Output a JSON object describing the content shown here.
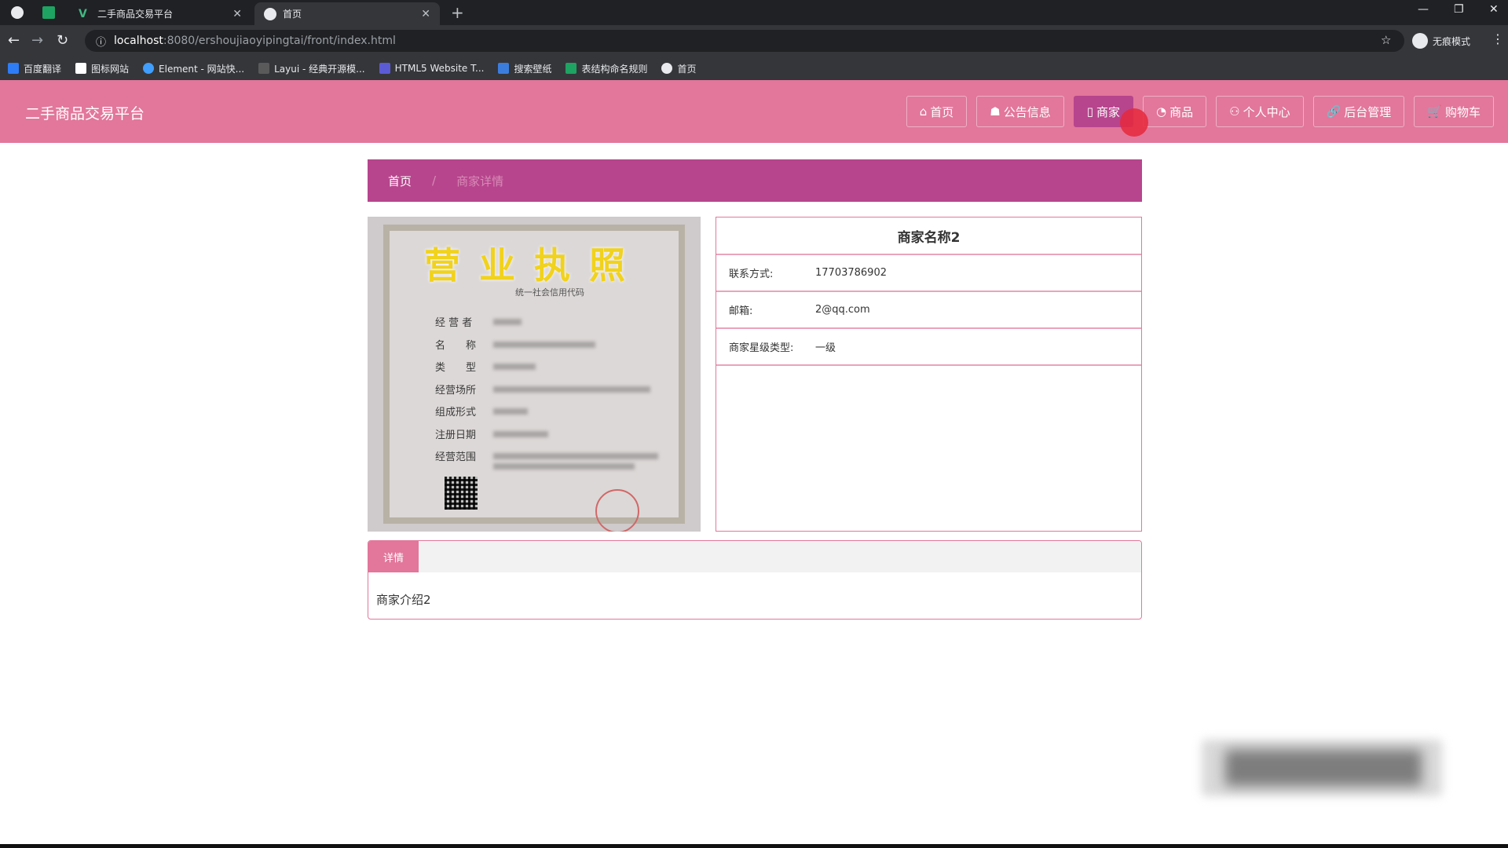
{
  "browser": {
    "tabs": [
      {
        "title": "二手商品交易平台",
        "active": false
      },
      {
        "title": "首页",
        "active": true
      }
    ],
    "new_tab": "+",
    "address": {
      "host": "localhost",
      "path": ":8080/ershoujiaoyipingtai/front/index.html"
    },
    "profile_label": "无痕模式",
    "bookmarks": [
      "百度翻译",
      "图标网站",
      "Element - 网站快...",
      "Layui - 经典开源模...",
      "HTML5 Website T...",
      "搜索壁纸",
      "表结构命名规则",
      "首页"
    ]
  },
  "site": {
    "title": "二手商品交易平台",
    "nav": [
      {
        "icon": "⌂",
        "label": "首页",
        "active": false
      },
      {
        "icon": "☗",
        "label": "公告信息",
        "active": false
      },
      {
        "icon": "▯",
        "label": "商家",
        "active": true
      },
      {
        "icon": "◔",
        "label": "商品",
        "active": false
      },
      {
        "icon": "⚇",
        "label": "个人中心",
        "active": false
      },
      {
        "icon": "🔗",
        "label": "后台管理",
        "active": false
      },
      {
        "icon": "🛒",
        "label": "购物车",
        "active": false
      }
    ]
  },
  "breadcrumb": {
    "home": "首页",
    "separator": "/",
    "current": "商家详情"
  },
  "license": {
    "title": "营业执照",
    "credit_code_label": "统一社会信用代码",
    "fields": [
      "经 营 者",
      "名　　称",
      "类　　型",
      "经营场所",
      "组成形式",
      "注册日期",
      "经营范围"
    ]
  },
  "merchant": {
    "name": "商家名称2",
    "rows": [
      {
        "label": "联系方式:",
        "value": "17703786902"
      },
      {
        "label": "邮箱:",
        "value": "2@qq.com"
      },
      {
        "label": "商家星级类型:",
        "value": "一级"
      }
    ]
  },
  "details": {
    "tab_label": "详情",
    "content": "商家介绍2"
  },
  "colors": {
    "header": "#e2779b",
    "active": "#b7458d"
  }
}
